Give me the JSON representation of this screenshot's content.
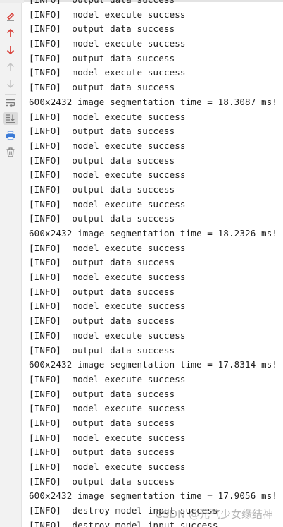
{
  "toolbar": {
    "tools": [
      {
        "name": "soft-wrap-edit-icon",
        "interactive": true
      },
      {
        "name": "arrow-up-icon",
        "interactive": true
      },
      {
        "name": "arrow-down-icon",
        "interactive": true
      },
      {
        "name": "arrow-up-disabled-icon",
        "interactive": false
      },
      {
        "name": "arrow-down-disabled-icon",
        "interactive": false
      },
      {
        "name": "soft-wrap-icon",
        "interactive": true
      },
      {
        "name": "scroll-to-end-icon",
        "interactive": true
      },
      {
        "name": "print-icon",
        "interactive": true
      },
      {
        "name": "trash-icon",
        "interactive": true
      }
    ],
    "colors": {
      "red": "#d9423b",
      "gray": "#7c7c7c",
      "light_gray": "#c3c3c3",
      "blue": "#3b7ad6"
    }
  },
  "console": {
    "lines": [
      "[INFO]  output data success",
      "[INFO]  model execute success",
      "[INFO]  output data success",
      "[INFO]  model execute success",
      "[INFO]  output data success",
      "[INFO]  model execute success",
      "[INFO]  output data success",
      "600x2432 image segmentation time = 18.3087 ms!",
      "[INFO]  model execute success",
      "[INFO]  output data success",
      "[INFO]  model execute success",
      "[INFO]  output data success",
      "[INFO]  model execute success",
      "[INFO]  output data success",
      "[INFO]  model execute success",
      "[INFO]  output data success",
      "600x2432 image segmentation time = 18.2326 ms!",
      "[INFO]  model execute success",
      "[INFO]  output data success",
      "[INFO]  model execute success",
      "[INFO]  output data success",
      "[INFO]  model execute success",
      "[INFO]  output data success",
      "[INFO]  model execute success",
      "[INFO]  output data success",
      "600x2432 image segmentation time = 17.8314 ms!",
      "[INFO]  model execute success",
      "[INFO]  output data success",
      "[INFO]  model execute success",
      "[INFO]  output data success",
      "[INFO]  model execute success",
      "[INFO]  output data success",
      "[INFO]  model execute success",
      "[INFO]  output data success",
      "600x2432 image segmentation time = 17.9056 ms!",
      "[INFO]  destroy model input success",
      "[INFO]  destroy model input success"
    ]
  },
  "watermark": "CSDN @元气少女缘结神"
}
